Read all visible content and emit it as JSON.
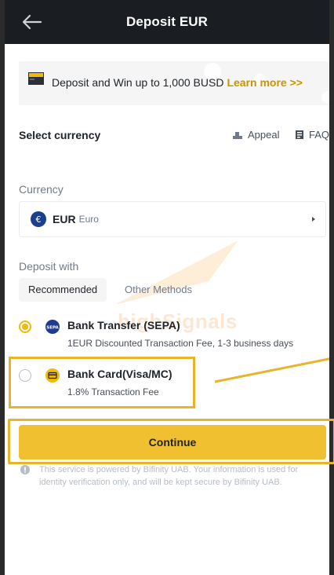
{
  "header": {
    "title": "Deposit EUR"
  },
  "banner": {
    "text": "Deposit and Win up to 1,000 BUSD",
    "link": "Learn more >>"
  },
  "select_currency": {
    "label": "Select currency",
    "appeal": "Appeal",
    "faq": "FAQ"
  },
  "currency": {
    "label": "Currency",
    "code": "EUR",
    "name": "Euro"
  },
  "deposit_with": {
    "label": "Deposit with",
    "tabs": [
      "Recommended",
      "Other Methods"
    ],
    "active_tab": "Recommended"
  },
  "methods": [
    {
      "title": "Bank Transfer (SEPA)",
      "subtitle": "1EUR Discounted Transaction Fee, 1-3 business days",
      "selected": true,
      "icon": "sepa-icon"
    },
    {
      "title": "Bank Card(Visa/MC)",
      "subtitle": "1.8% Transaction Fee",
      "selected": false,
      "icon": "card-icon"
    }
  ],
  "continue_label": "Continue",
  "notice": "This service is powered by Bifinity UAB. Your information is used for identity verification only, and will be kept secure by Bifinity UAB.",
  "watermark": "highSignals",
  "colors": {
    "accent": "#f0b90b",
    "link": "#c99400",
    "highlight": "#e8b52a",
    "header_bg": "#1a1d21"
  }
}
